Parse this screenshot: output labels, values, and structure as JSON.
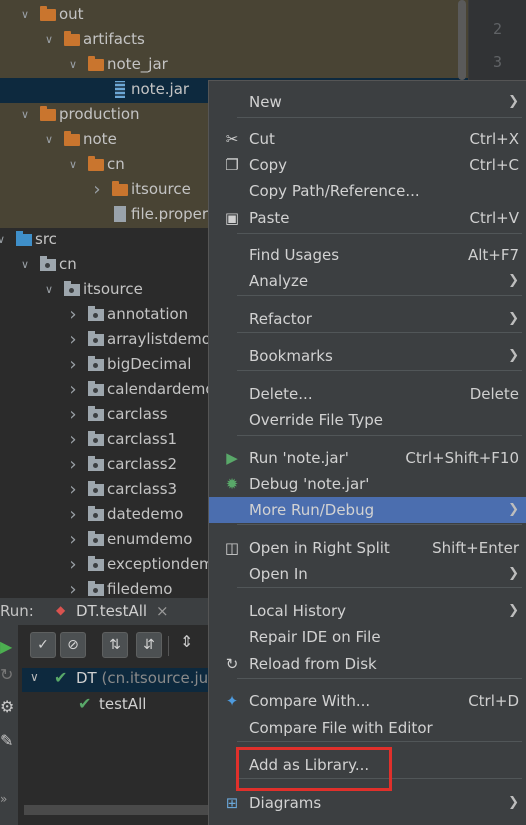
{
  "tree": {
    "rows": [
      {
        "label": "out",
        "icon": "folder-excluded-icon",
        "arrow": "down"
      },
      {
        "label": "artifacts",
        "icon": "folder-excluded-icon",
        "arrow": "down"
      },
      {
        "label": "note_jar",
        "icon": "folder-excluded-icon",
        "arrow": "down"
      },
      {
        "label": "note.jar",
        "icon": "jar-file-icon",
        "arrow": ""
      },
      {
        "label": "production",
        "icon": "folder-excluded-icon",
        "arrow": "down"
      },
      {
        "label": "note",
        "icon": "folder-excluded-icon",
        "arrow": "down"
      },
      {
        "label": "cn",
        "icon": "folder-excluded-icon",
        "arrow": "down"
      },
      {
        "label": "itsource",
        "icon": "folder-excluded-icon",
        "arrow": "right"
      },
      {
        "label": "file.properties",
        "icon": "properties-file-icon",
        "arrow": ""
      },
      {
        "label": "src",
        "icon": "source-folder-icon",
        "arrow": "down"
      },
      {
        "label": "cn",
        "icon": "package-icon",
        "arrow": "down"
      },
      {
        "label": "itsource",
        "icon": "package-icon",
        "arrow": "down"
      },
      {
        "label": "annotation",
        "icon": "package-icon",
        "arrow": "right"
      },
      {
        "label": "arraylistdemo",
        "icon": "package-icon",
        "arrow": "right"
      },
      {
        "label": "bigDecimal",
        "icon": "package-icon",
        "arrow": "right"
      },
      {
        "label": "calendardemo",
        "icon": "package-icon",
        "arrow": "right"
      },
      {
        "label": "carclass",
        "icon": "package-icon",
        "arrow": "right"
      },
      {
        "label": "carclass1",
        "icon": "package-icon",
        "arrow": "right"
      },
      {
        "label": "carclass2",
        "icon": "package-icon",
        "arrow": "right"
      },
      {
        "label": "carclass3",
        "icon": "package-icon",
        "arrow": "right"
      },
      {
        "label": "datedemo",
        "icon": "package-icon",
        "arrow": "right"
      },
      {
        "label": "enumdemo",
        "icon": "package-icon",
        "arrow": "right"
      },
      {
        "label": "exceptiondemo",
        "icon": "package-icon",
        "arrow": "right"
      },
      {
        "label": "filedemo",
        "icon": "package-icon",
        "arrow": "right"
      }
    ]
  },
  "gutter": {
    "lines": [
      "2",
      "3"
    ]
  },
  "run": {
    "label": "Run:",
    "tab": "DT.testAll",
    "tab_close": "×",
    "test_class": "DT",
    "test_class_pkg": "(cn.itsource.junit)",
    "test_method": "testAll"
  },
  "menu": {
    "items": [
      {
        "label": "New",
        "shortcut": "",
        "submenu": true,
        "icon": ""
      },
      {
        "label": "Cut",
        "shortcut": "Ctrl+X",
        "submenu": false,
        "icon": "scissors-icon"
      },
      {
        "label": "Copy",
        "shortcut": "Ctrl+C",
        "submenu": false,
        "icon": "copy-icon"
      },
      {
        "label": "Copy Path/Reference...",
        "shortcut": "",
        "submenu": false,
        "icon": ""
      },
      {
        "label": "Paste",
        "shortcut": "Ctrl+V",
        "submenu": false,
        "icon": "paste-icon"
      },
      {
        "label": "Find Usages",
        "shortcut": "Alt+F7",
        "submenu": false,
        "icon": ""
      },
      {
        "label": "Analyze",
        "shortcut": "",
        "submenu": true,
        "icon": ""
      },
      {
        "label": "Refactor",
        "shortcut": "",
        "submenu": true,
        "icon": ""
      },
      {
        "label": "Bookmarks",
        "shortcut": "",
        "submenu": true,
        "icon": ""
      },
      {
        "label": "Delete...",
        "shortcut": "Delete",
        "submenu": false,
        "icon": ""
      },
      {
        "label": "Override File Type",
        "shortcut": "",
        "submenu": false,
        "icon": ""
      },
      {
        "label": "Run 'note.jar'",
        "shortcut": "Ctrl+Shift+F10",
        "submenu": false,
        "icon": "run-icon"
      },
      {
        "label": "Debug 'note.jar'",
        "shortcut": "",
        "submenu": false,
        "icon": "debug-icon"
      },
      {
        "label": "More Run/Debug",
        "shortcut": "",
        "submenu": true,
        "icon": ""
      },
      {
        "label": "Open in Right Split",
        "shortcut": "Shift+Enter",
        "submenu": false,
        "icon": "split-icon"
      },
      {
        "label": "Open In",
        "shortcut": "",
        "submenu": true,
        "icon": ""
      },
      {
        "label": "Local History",
        "shortcut": "",
        "submenu": true,
        "icon": ""
      },
      {
        "label": "Repair IDE on File",
        "shortcut": "",
        "submenu": false,
        "icon": ""
      },
      {
        "label": "Reload from Disk",
        "shortcut": "",
        "submenu": false,
        "icon": "reload-icon"
      },
      {
        "label": "Compare With...",
        "shortcut": "Ctrl+D",
        "submenu": false,
        "icon": "compare-icon"
      },
      {
        "label": "Compare File with Editor",
        "shortcut": "",
        "submenu": false,
        "icon": ""
      },
      {
        "label": "Add as Library...",
        "shortcut": "",
        "submenu": false,
        "icon": ""
      },
      {
        "label": "Diagrams",
        "shortcut": "",
        "submenu": true,
        "icon": "diagram-icon"
      }
    ]
  },
  "colors": {
    "selected": "#4b6eaf",
    "highlight_box": "#e0302b",
    "excluded_bg": "#4a4536"
  }
}
